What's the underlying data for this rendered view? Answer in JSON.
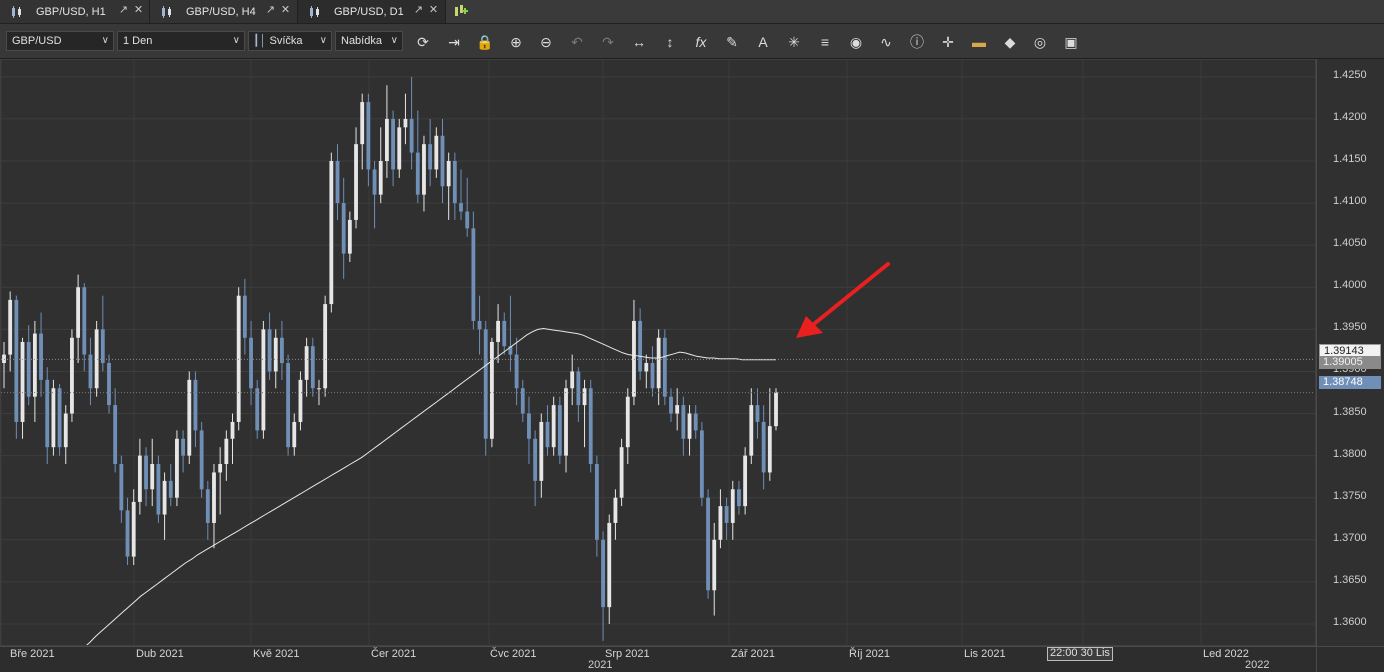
{
  "tabs": [
    {
      "label": "GBP/USD, H1",
      "active": false
    },
    {
      "label": "GBP/USD, H4",
      "active": false
    },
    {
      "label": "GBP/USD, D1",
      "active": true
    }
  ],
  "toolbar": {
    "symbol": "GBP/USD",
    "timeframe": "1 Den",
    "chart_type": "Svíčka",
    "price_type": "Nabídka",
    "icons": [
      "refresh-icon",
      "auto-scroll-icon",
      "lock-icon",
      "zoom-in-icon",
      "zoom-out-icon",
      "undo-icon",
      "redo-icon",
      "fit-horizontal-icon",
      "fit-vertical-icon",
      "indicator-fx-icon",
      "pencil-icon",
      "text-icon",
      "drawing-tools-icon",
      "layers-icon",
      "visibility-icon",
      "signal-icon",
      "info-icon",
      "crosshair-icon",
      "price-marker-icon",
      "paint-bucket-icon",
      "cycle-icon",
      "save-icon"
    ]
  },
  "colors": {
    "background": "#303030",
    "bull_candle": "#e6e6e6",
    "bear_candle": "#6f8fb7",
    "ma_line": "#e8e8e8",
    "arrow": "#e82020",
    "last_price_tag": "#6f8fb7"
  },
  "price_tags": {
    "ma_value": "1.39143",
    "second_value": "1.39005",
    "last_price": "1.38748"
  },
  "crosshair_time": "22:00 30 Lis",
  "chart_data": {
    "type": "candlestick",
    "ylim": [
      1.3575,
      1.427
    ],
    "y_ticks": [
      "1.4250",
      "1.4200",
      "1.4150",
      "1.4100",
      "1.4050",
      "1.4000",
      "1.3950",
      "1.3900",
      "1.3850",
      "1.3800",
      "1.3750",
      "1.3700",
      "1.3650",
      "1.3600"
    ],
    "x_ticks": [
      "Bře 2021",
      "Dub 2021",
      "Kvě 2021",
      "Čer 2021",
      "Čvc 2021",
      "Srp 2021",
      "Zář 2021",
      "Říj 2021",
      "Lis 2021",
      "Led 2022"
    ],
    "x_years": [
      "2021",
      "2022"
    ],
    "candles": [
      [
        1.391,
        1.3935,
        1.388,
        1.392
      ],
      [
        1.392,
        1.3995,
        1.39,
        1.3985
      ],
      [
        1.3985,
        1.399,
        1.382,
        1.384
      ],
      [
        1.384,
        1.394,
        1.382,
        1.3935
      ],
      [
        1.3935,
        1.3955,
        1.386,
        1.387
      ],
      [
        1.387,
        1.396,
        1.384,
        1.3945
      ],
      [
        1.3945,
        1.397,
        1.387,
        1.389
      ],
      [
        1.389,
        1.3905,
        1.379,
        1.381
      ],
      [
        1.381,
        1.389,
        1.38,
        1.388
      ],
      [
        1.388,
        1.3885,
        1.38,
        1.381
      ],
      [
        1.381,
        1.386,
        1.379,
        1.385
      ],
      [
        1.385,
        1.395,
        1.384,
        1.394
      ],
      [
        1.394,
        1.4015,
        1.391,
        1.4
      ],
      [
        1.4,
        1.4005,
        1.39,
        1.392
      ],
      [
        1.392,
        1.394,
        1.386,
        1.388
      ],
      [
        1.388,
        1.396,
        1.387,
        1.395
      ],
      [
        1.395,
        1.399,
        1.39,
        1.391
      ],
      [
        1.391,
        1.392,
        1.385,
        1.386
      ],
      [
        1.386,
        1.388,
        1.378,
        1.379
      ],
      [
        1.379,
        1.38,
        1.372,
        1.3735
      ],
      [
        1.3735,
        1.375,
        1.367,
        1.368
      ],
      [
        1.368,
        1.376,
        1.367,
        1.3745
      ],
      [
        1.3745,
        1.382,
        1.373,
        1.38
      ],
      [
        1.38,
        1.381,
        1.374,
        1.376
      ],
      [
        1.376,
        1.382,
        1.374,
        1.379
      ],
      [
        1.379,
        1.38,
        1.372,
        1.373
      ],
      [
        1.373,
        1.378,
        1.37,
        1.377
      ],
      [
        1.377,
        1.379,
        1.374,
        1.375
      ],
      [
        1.375,
        1.383,
        1.374,
        1.382
      ],
      [
        1.382,
        1.383,
        1.378,
        1.38
      ],
      [
        1.38,
        1.39,
        1.379,
        1.389
      ],
      [
        1.389,
        1.39,
        1.381,
        1.383
      ],
      [
        1.383,
        1.384,
        1.375,
        1.376
      ],
      [
        1.376,
        1.377,
        1.37,
        1.372
      ],
      [
        1.372,
        1.379,
        1.369,
        1.378
      ],
      [
        1.378,
        1.381,
        1.373,
        1.379
      ],
      [
        1.379,
        1.383,
        1.377,
        1.382
      ],
      [
        1.382,
        1.385,
        1.379,
        1.384
      ],
      [
        1.384,
        1.4,
        1.383,
        1.399
      ],
      [
        1.399,
        1.401,
        1.392,
        1.394
      ],
      [
        1.394,
        1.396,
        1.386,
        1.388
      ],
      [
        1.388,
        1.389,
        1.382,
        1.383
      ],
      [
        1.383,
        1.396,
        1.382,
        1.395
      ],
      [
        1.395,
        1.397,
        1.389,
        1.39
      ],
      [
        1.39,
        1.395,
        1.388,
        1.394
      ],
      [
        1.394,
        1.396,
        1.389,
        1.391
      ],
      [
        1.391,
        1.392,
        1.38,
        1.381
      ],
      [
        1.381,
        1.385,
        1.38,
        1.384
      ],
      [
        1.384,
        1.39,
        1.383,
        1.389
      ],
      [
        1.389,
        1.394,
        1.387,
        1.393
      ],
      [
        1.393,
        1.394,
        1.387,
        1.388
      ],
      [
        1.388,
        1.389,
        1.386,
        1.388
      ],
      [
        1.388,
        1.399,
        1.387,
        1.398
      ],
      [
        1.398,
        1.416,
        1.397,
        1.415
      ],
      [
        1.415,
        1.417,
        1.408,
        1.41
      ],
      [
        1.41,
        1.413,
        1.401,
        1.404
      ],
      [
        1.404,
        1.409,
        1.403,
        1.408
      ],
      [
        1.408,
        1.419,
        1.407,
        1.417
      ],
      [
        1.417,
        1.423,
        1.414,
        1.422
      ],
      [
        1.422,
        1.423,
        1.412,
        1.414
      ],
      [
        1.414,
        1.415,
        1.407,
        1.411
      ],
      [
        1.411,
        1.419,
        1.41,
        1.415
      ],
      [
        1.415,
        1.424,
        1.413,
        1.42
      ],
      [
        1.42,
        1.421,
        1.412,
        1.414
      ],
      [
        1.414,
        1.42,
        1.413,
        1.419
      ],
      [
        1.419,
        1.423,
        1.417,
        1.42
      ],
      [
        1.42,
        1.425,
        1.414,
        1.416
      ],
      [
        1.416,
        1.421,
        1.41,
        1.411
      ],
      [
        1.411,
        1.418,
        1.409,
        1.417
      ],
      [
        1.417,
        1.42,
        1.412,
        1.414
      ],
      [
        1.414,
        1.419,
        1.413,
        1.418
      ],
      [
        1.418,
        1.42,
        1.41,
        1.412
      ],
      [
        1.412,
        1.416,
        1.408,
        1.415
      ],
      [
        1.415,
        1.416,
        1.408,
        1.41
      ],
      [
        1.41,
        1.414,
        1.408,
        1.409
      ],
      [
        1.409,
        1.413,
        1.406,
        1.407
      ],
      [
        1.407,
        1.409,
        1.395,
        1.396
      ],
      [
        1.396,
        1.399,
        1.392,
        1.395
      ],
      [
        1.395,
        1.396,
        1.38,
        1.382
      ],
      [
        1.382,
        1.394,
        1.381,
        1.3935
      ],
      [
        1.3935,
        1.398,
        1.391,
        1.396
      ],
      [
        1.396,
        1.397,
        1.392,
        1.393
      ],
      [
        1.393,
        1.399,
        1.39,
        1.392
      ],
      [
        1.392,
        1.394,
        1.386,
        1.388
      ],
      [
        1.388,
        1.389,
        1.384,
        1.385
      ],
      [
        1.385,
        1.387,
        1.379,
        1.382
      ],
      [
        1.382,
        1.383,
        1.374,
        1.377
      ],
      [
        1.377,
        1.385,
        1.375,
        1.384
      ],
      [
        1.384,
        1.386,
        1.38,
        1.381
      ],
      [
        1.381,
        1.387,
        1.38,
        1.386
      ],
      [
        1.386,
        1.387,
        1.379,
        1.38
      ],
      [
        1.38,
        1.389,
        1.378,
        1.388
      ],
      [
        1.388,
        1.392,
        1.386,
        1.39
      ],
      [
        1.39,
        1.3905,
        1.384,
        1.386
      ],
      [
        1.386,
        1.389,
        1.381,
        1.388
      ],
      [
        1.388,
        1.389,
        1.378,
        1.379
      ],
      [
        1.379,
        1.38,
        1.368,
        1.37
      ],
      [
        1.37,
        1.371,
        1.358,
        1.362
      ],
      [
        1.362,
        1.373,
        1.36,
        1.372
      ],
      [
        1.372,
        1.376,
        1.37,
        1.375
      ],
      [
        1.375,
        1.382,
        1.374,
        1.381
      ],
      [
        1.381,
        1.388,
        1.379,
        1.387
      ],
      [
        1.387,
        1.3985,
        1.386,
        1.396
      ],
      [
        1.396,
        1.3975,
        1.389,
        1.39
      ],
      [
        1.39,
        1.392,
        1.388,
        1.391
      ],
      [
        1.391,
        1.393,
        1.387,
        1.388
      ],
      [
        1.388,
        1.395,
        1.386,
        1.394
      ],
      [
        1.394,
        1.395,
        1.386,
        1.387
      ],
      [
        1.387,
        1.388,
        1.384,
        1.385
      ],
      [
        1.385,
        1.388,
        1.383,
        1.386
      ],
      [
        1.386,
        1.387,
        1.38,
        1.382
      ],
      [
        1.382,
        1.386,
        1.38,
        1.385
      ],
      [
        1.385,
        1.386,
        1.382,
        1.383
      ],
      [
        1.383,
        1.384,
        1.374,
        1.375
      ],
      [
        1.375,
        1.376,
        1.363,
        1.364
      ],
      [
        1.364,
        1.372,
        1.361,
        1.37
      ],
      [
        1.37,
        1.376,
        1.369,
        1.374
      ],
      [
        1.374,
        1.375,
        1.37,
        1.372
      ],
      [
        1.372,
        1.377,
        1.37,
        1.376
      ],
      [
        1.376,
        1.377,
        1.373,
        1.374
      ],
      [
        1.374,
        1.381,
        1.373,
        1.38
      ],
      [
        1.38,
        1.388,
        1.379,
        1.386
      ],
      [
        1.386,
        1.388,
        1.382,
        1.384
      ],
      [
        1.384,
        1.386,
        1.376,
        1.378
      ],
      [
        1.378,
        1.388,
        1.377,
        1.3835
      ],
      [
        1.3835,
        1.388,
        1.383,
        1.3875
      ]
    ],
    "ma": [
      1.3555,
      1.356,
      1.3566,
      1.3572,
      1.3578,
      1.3585,
      1.3591,
      1.3597,
      1.3603,
      1.3609,
      1.3615,
      1.3621,
      1.3627,
      1.3633,
      1.3638,
      1.3643,
      1.3648,
      1.3653,
      1.3658,
      1.3663,
      1.3668,
      1.3673,
      1.3677,
      1.3682,
      1.3686,
      1.369,
      1.3694,
      1.3698,
      1.3702,
      1.3706,
      1.371,
      1.3714,
      1.3718,
      1.3722,
      1.3726,
      1.373,
      1.3734,
      1.3738,
      1.3742,
      1.3746,
      1.375,
      1.3754,
      1.3758,
      1.3762,
      1.3766,
      1.377,
      1.3774,
      1.3778,
      1.3782,
      1.3786,
      1.379,
      1.3794,
      1.3798,
      1.3803,
      1.3808,
      1.3813,
      1.3818,
      1.3823,
      1.3828,
      1.3833,
      1.3838,
      1.3843,
      1.3848,
      1.3853,
      1.3858,
      1.3863,
      1.3868,
      1.3873,
      1.3878,
      1.3883,
      1.3888,
      1.3893,
      1.3898,
      1.3903,
      1.3908,
      1.3913,
      1.3918,
      1.3923,
      1.3928,
      1.3933,
      1.3938,
      1.3943,
      1.3947,
      1.395,
      1.3951,
      1.395,
      1.3949,
      1.3948,
      1.3947,
      1.3946,
      1.3945,
      1.3943,
      1.394,
      1.3937,
      1.3934,
      1.3931,
      1.3928,
      1.3925,
      1.3922,
      1.392,
      1.3919,
      1.3918,
      1.3917,
      1.3916,
      1.3916,
      1.3917,
      1.3919,
      1.3921,
      1.3923,
      1.3922,
      1.392,
      1.3918,
      1.3917,
      1.3916,
      1.3916,
      1.3915,
      1.3915,
      1.3915,
      1.3915,
      1.3914,
      1.3914,
      1.3914,
      1.3914,
      1.3914,
      1.3914,
      1.3914
    ]
  }
}
